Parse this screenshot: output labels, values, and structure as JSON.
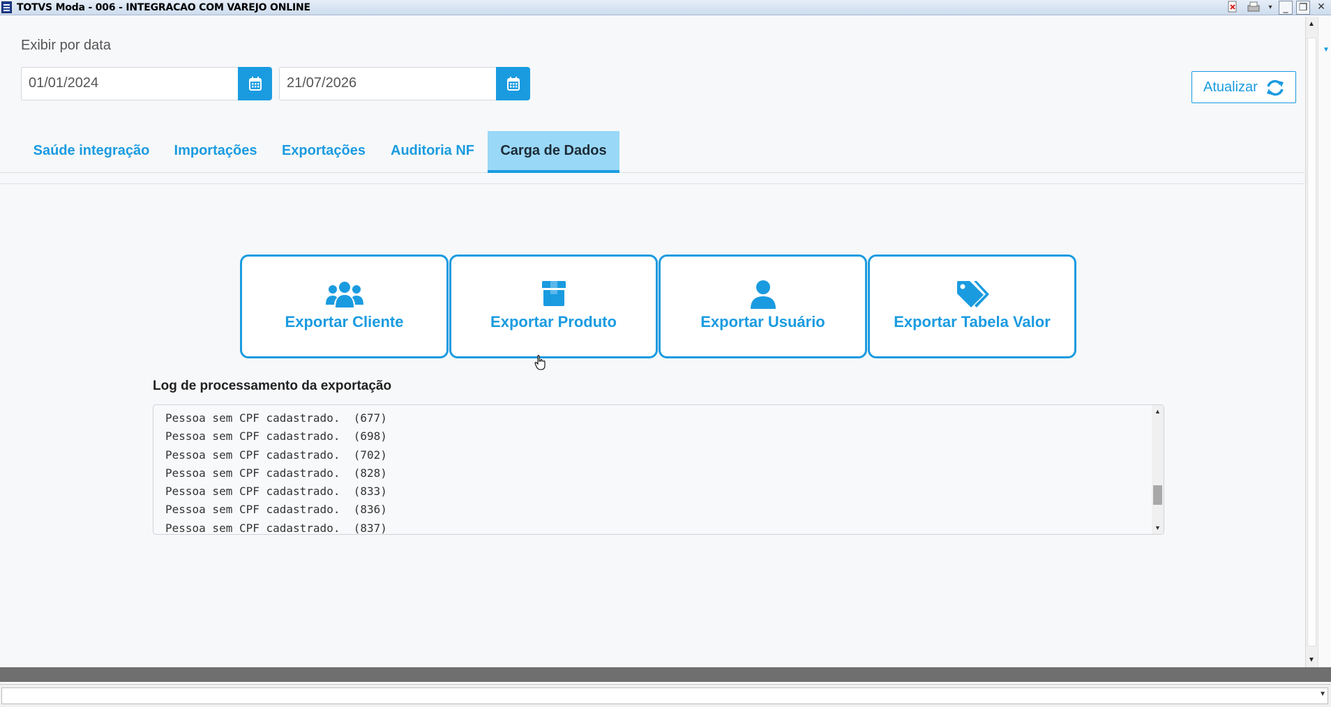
{
  "window": {
    "title": "TOTVS Moda - 006 - INTEGRACAO COM VAREJO ONLINE",
    "controls": [
      "minimize",
      "restore",
      "close"
    ]
  },
  "filter": {
    "label": "Exibir por data",
    "start_date": "01/01/2024",
    "end_date": "21/07/2026",
    "refresh_label": "Atualizar"
  },
  "tabs": [
    {
      "label": "Saúde integração",
      "active": false
    },
    {
      "label": "Importações",
      "active": false
    },
    {
      "label": "Exportações",
      "active": false
    },
    {
      "label": "Auditoria NF",
      "active": false
    },
    {
      "label": "Carga de Dados",
      "active": true
    }
  ],
  "export_buttons": [
    {
      "label": "Exportar Cliente",
      "icon": "users-icon"
    },
    {
      "label": "Exportar Produto",
      "icon": "box-icon"
    },
    {
      "label": "Exportar Usuário",
      "icon": "user-icon"
    },
    {
      "label": "Exportar Tabela Valor",
      "icon": "tags-icon"
    }
  ],
  "log": {
    "title": "Log de processamento da exportação",
    "lines": [
      "Pessoa sem CPF cadastrado.  (677)",
      "Pessoa sem CPF cadastrado.  (698)",
      "Pessoa sem CPF cadastrado.  (702)",
      "Pessoa sem CPF cadastrado.  (828)",
      "Pessoa sem CPF cadastrado.  (833)",
      "Pessoa sem CPF cadastrado.  (836)",
      "Pessoa sem CPF cadastrado.  (837)"
    ]
  },
  "colors": {
    "accent": "#1a9be0",
    "active_tab_bg": "#99d8f6",
    "page_bg": "#f7f8fa"
  }
}
